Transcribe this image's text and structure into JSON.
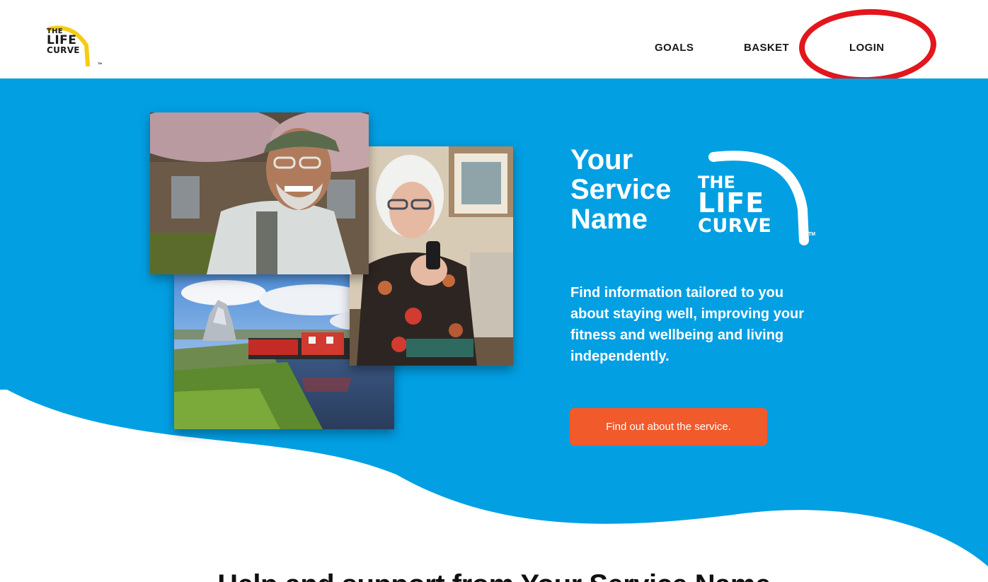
{
  "brand": {
    "logo_lines": [
      "THE",
      "LIFE",
      "CURVE"
    ],
    "trademark": "TM",
    "colors": {
      "primary_blue": "#029fe3",
      "accent_yellow": "#f6cc12",
      "cta_orange": "#f15a2b",
      "annotation_red": "#e3161c"
    }
  },
  "nav": {
    "items": [
      {
        "label": "GOALS"
      },
      {
        "label": "BASKET"
      },
      {
        "label": "LOGIN"
      }
    ]
  },
  "hero": {
    "title_lines": [
      "Your",
      "Service",
      "Name"
    ],
    "description": "Find information tailored to you about staying well, improving your fitness and wellbeing and living independently.",
    "cta_label": "Find out about the service.",
    "photos": [
      {
        "name": "older-man-in-cap-photo"
      },
      {
        "name": "older-woman-with-phone-photo"
      },
      {
        "name": "kelpies-canal-boat-photo"
      }
    ]
  },
  "section": {
    "title": "Help and support from Your Service Name"
  }
}
